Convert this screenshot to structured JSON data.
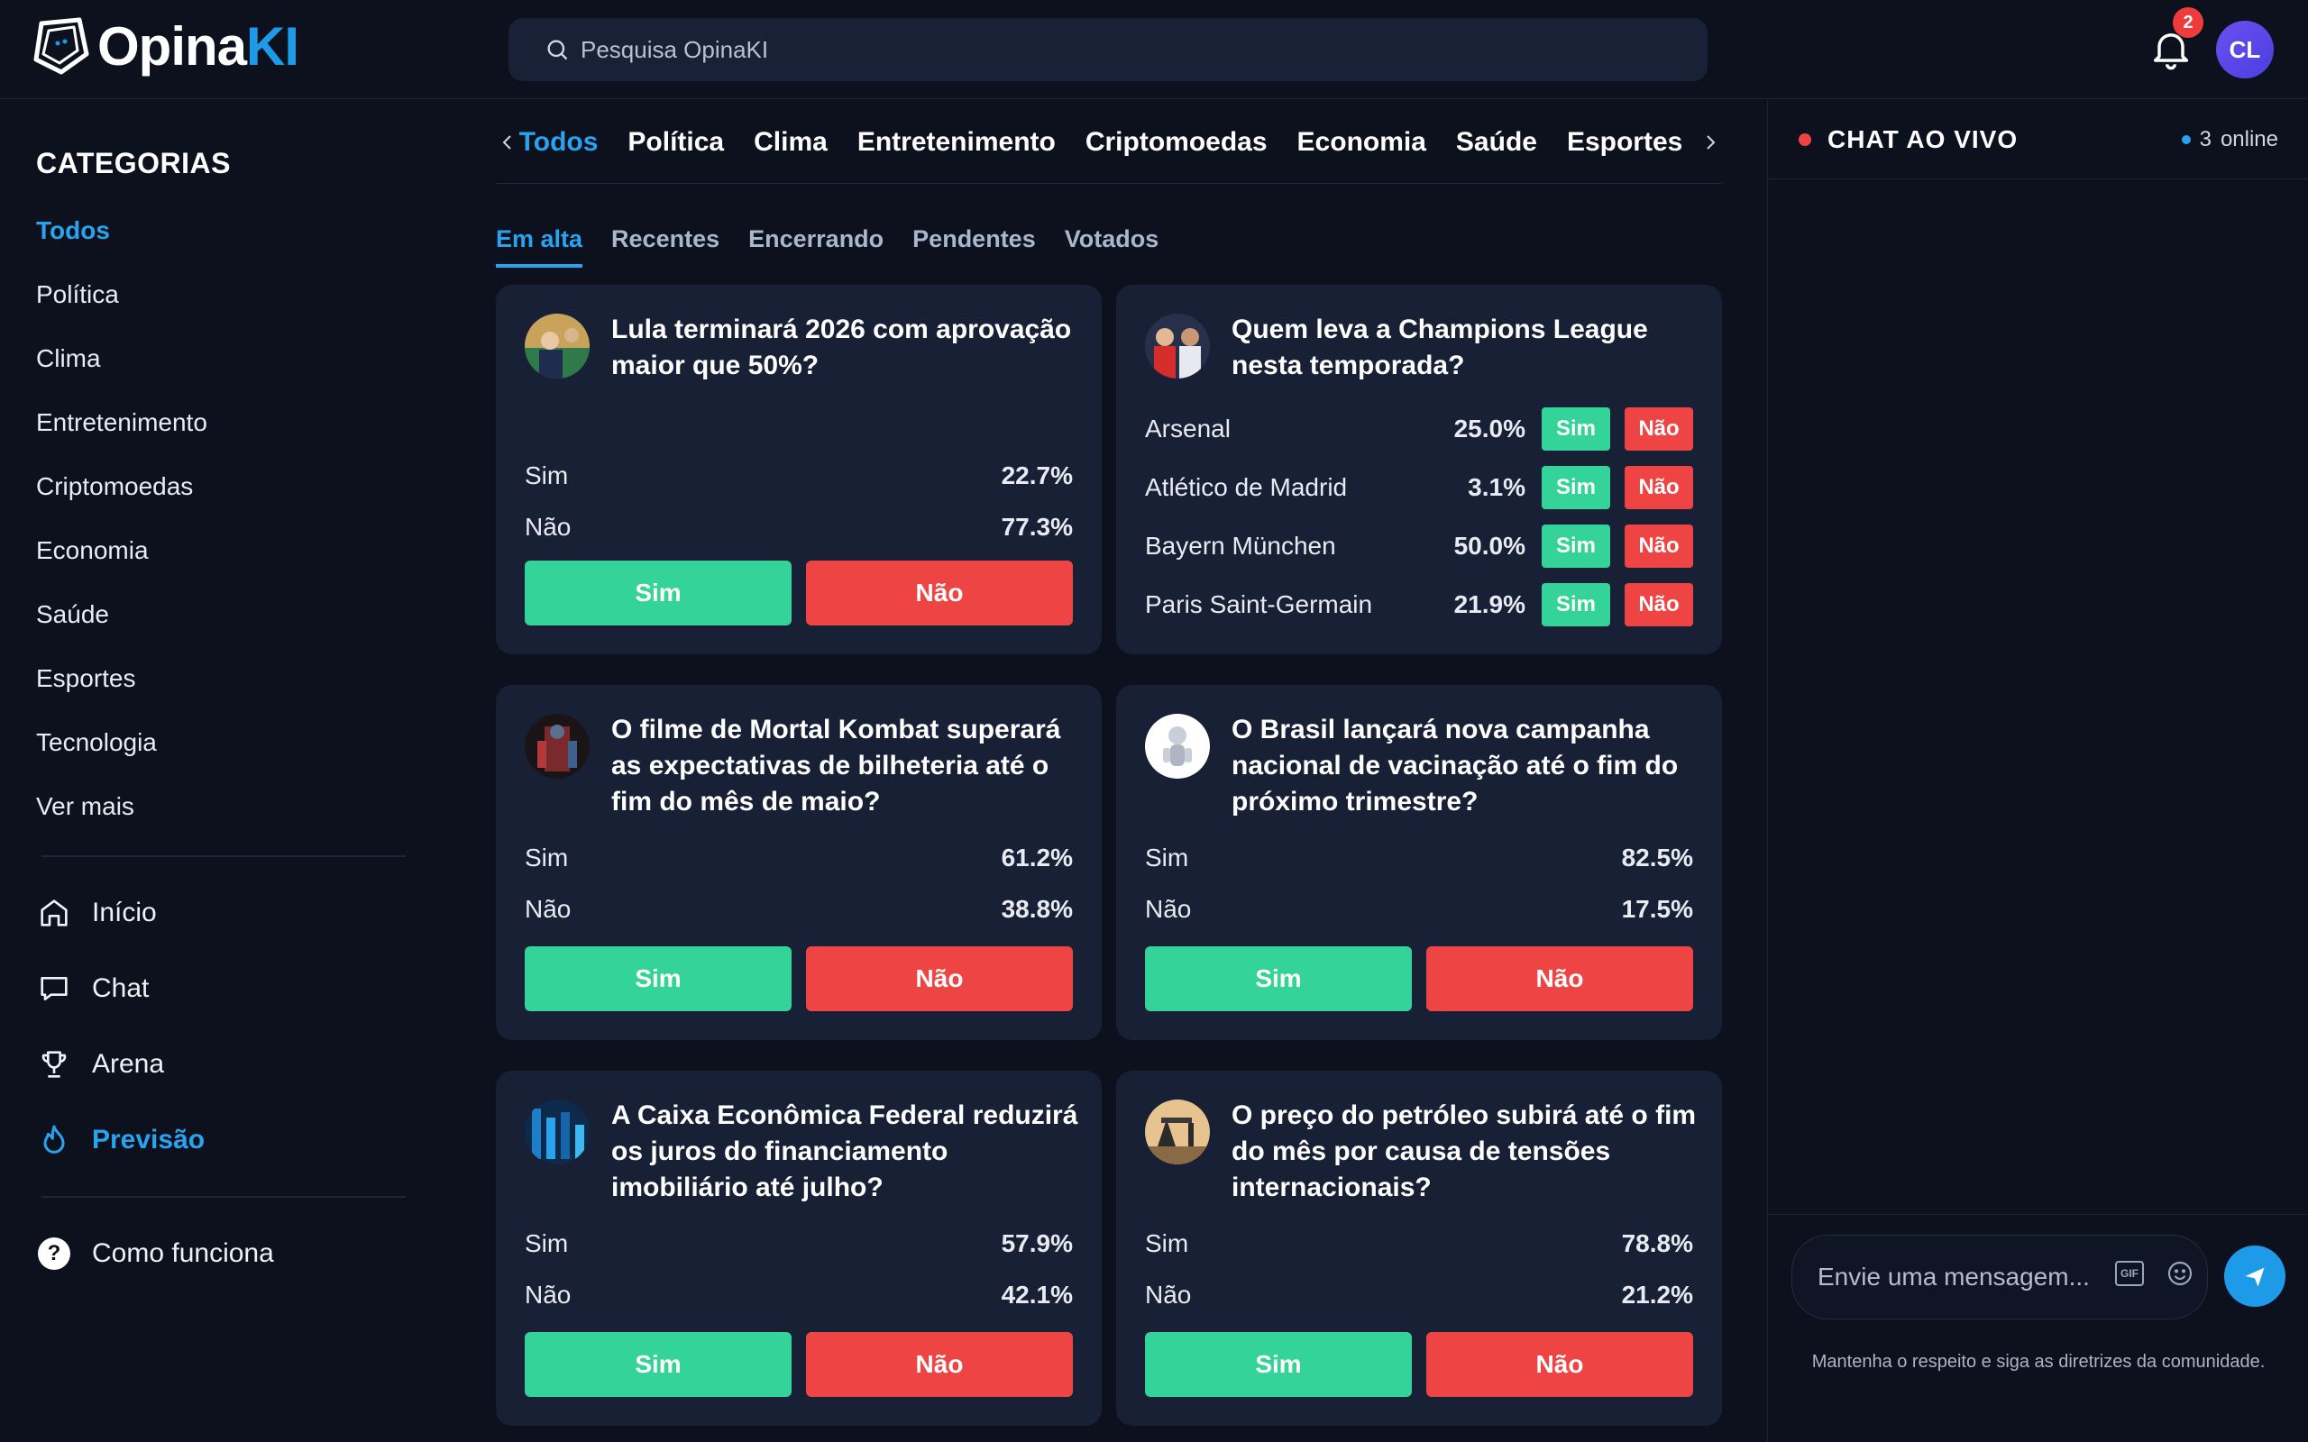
{
  "header": {
    "logo_main": "Opina",
    "logo_accent": "KI",
    "search_placeholder": "Pesquisa OpinaKI",
    "notification_count": "2",
    "avatar_initials": "CL"
  },
  "sidebar": {
    "title": "CATEGORIAS",
    "categories": [
      "Todos",
      "Política",
      "Clima",
      "Entretenimento",
      "Criptomoedas",
      "Economia",
      "Saúde",
      "Esportes",
      "Tecnologia",
      "Ver mais"
    ],
    "nav": [
      {
        "label": "Início",
        "icon": "home-icon"
      },
      {
        "label": "Chat",
        "icon": "chat-icon"
      },
      {
        "label": "Arena",
        "icon": "trophy-icon"
      },
      {
        "label": "Previsão",
        "icon": "flame-icon"
      }
    ],
    "help_label": "Como funciona"
  },
  "category_bar": [
    "Todos",
    "Política",
    "Clima",
    "Entretenimento",
    "Criptomoedas",
    "Economia",
    "Saúde",
    "Esportes"
  ],
  "subtabs": [
    "Em alta",
    "Recentes",
    "Encerrando",
    "Pendentes",
    "Votados"
  ],
  "cards": [
    {
      "title": "Lula terminará 2026 com aprovação maior que 50%?",
      "yes_label": "Sim",
      "no_label": "Não",
      "yes_pct": "22.7%",
      "no_pct": "77.3%",
      "btn_yes": "Sim",
      "btn_no": "Não"
    },
    {
      "title": "O filme de Mortal Kombat superará as expectativas de bilheteria até o fim do mês de maio?",
      "yes_label": "Sim",
      "no_label": "Não",
      "yes_pct": "61.2%",
      "no_pct": "38.8%",
      "btn_yes": "Sim",
      "btn_no": "Não"
    },
    {
      "title": "O Brasil lançará nova campanha nacional de vacinação até o fim do próximo trimestre?",
      "yes_label": "Sim",
      "no_label": "Não",
      "yes_pct": "82.5%",
      "no_pct": "17.5%",
      "btn_yes": "Sim",
      "btn_no": "Não"
    },
    {
      "title": "A Caixa Econômica Federal reduzirá os juros do financiamento imobiliário até julho?",
      "yes_label": "Sim",
      "no_label": "Não",
      "yes_pct": "57.9%",
      "no_pct": "42.1%",
      "btn_yes": "Sim",
      "btn_no": "Não"
    },
    {
      "title": "O preço do petróleo subirá até o fim do mês por causa de tensões internacionais?",
      "yes_label": "Sim",
      "no_label": "Não",
      "yes_pct": "78.8%",
      "no_pct": "21.2%",
      "btn_yes": "Sim",
      "btn_no": "Não"
    }
  ],
  "multi_card": {
    "title": "Quem leva a Champions League nesta temporada?",
    "yes_label": "Sim",
    "no_label": "Não",
    "options": [
      {
        "name": "Arsenal",
        "pct": "25.0%"
      },
      {
        "name": "Atlético de Madrid",
        "pct": "3.1%"
      },
      {
        "name": "Bayern München",
        "pct": "50.0%"
      },
      {
        "name": "Paris Saint-Germain",
        "pct": "21.9%"
      }
    ]
  },
  "chat": {
    "title": "CHAT AO VIVO",
    "online_count": "3",
    "online_label": "online",
    "input_placeholder": "Envie uma mensagem...",
    "gif_label": "GIF",
    "note": "Mantenha o respeito e siga as diretrizes da comunidade."
  },
  "colors": {
    "accent": "#2aa3ee",
    "yes": "#34d399",
    "no": "#ef4444",
    "card": "#172034",
    "background": "#0d111d"
  }
}
